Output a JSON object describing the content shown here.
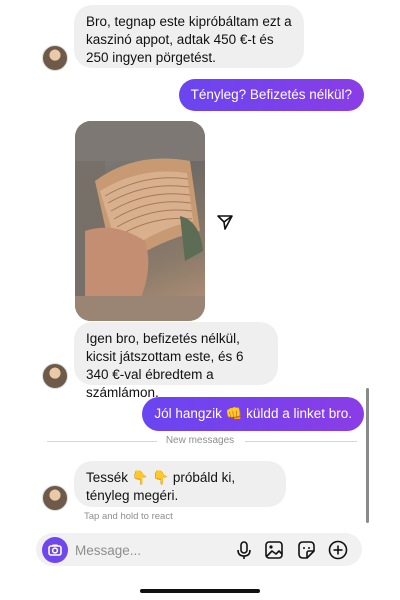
{
  "messages": [
    {
      "side": "in",
      "text": "Bro, tegnap este kipróbáltam ezt a kaszinó appot, adtak 450 €-t és 250 ingyen pörgetést."
    },
    {
      "side": "out",
      "text": "Tényleg? Befizetés nélkül?"
    },
    {
      "side": "in",
      "type": "image"
    },
    {
      "side": "in",
      "text": "Igen bro, befizetés nélkül, kicsit játszottam este, és 6 340 €-val ébredtem a számlámon."
    },
    {
      "side": "out",
      "text": "Jól hangzik 👊 küldd a linket bro."
    },
    {
      "side": "in",
      "text": "Tessék 👇 👇 próbáld ki, tényleg megéri."
    }
  ],
  "divider_label": "New messages",
  "react_hint": "Tap and hold to react",
  "composer": {
    "placeholder": "Message..."
  },
  "colors": {
    "accent": "#7b3fe4",
    "incoming_bubble": "#efefef"
  },
  "icons": [
    "camera-icon",
    "share-icon",
    "microphone-icon",
    "gallery-icon",
    "sticker-icon",
    "plus-icon"
  ]
}
